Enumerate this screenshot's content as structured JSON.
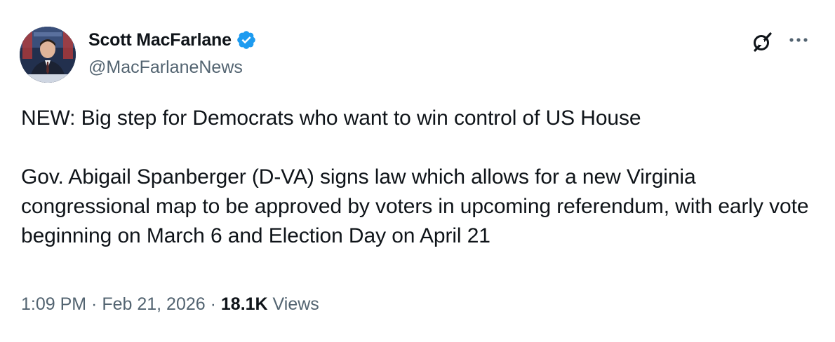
{
  "author": {
    "display_name": "Scott MacFarlane",
    "handle": "@MacFarlaneNews",
    "verified_icon": "verified-badge-icon",
    "avatar_icon": "avatar-photo"
  },
  "actions": {
    "grok_icon": "grok-icon",
    "more_icon": "more-horizontal-icon"
  },
  "tweet": {
    "text": "NEW:  Big step for Democrats who want to win control of US House\n\nGov. Abigail Spanberger (D-VA) signs law which allows for a new Virginia congressional map to be approved by voters in upcoming referendum, with early vote beginning on March 6 and Election Day on April 21"
  },
  "meta": {
    "time": "1:09 PM",
    "separator1": " · ",
    "date": "Feb 21, 2026",
    "separator2": " · ",
    "views_count": "18.1K",
    "views_label": " Views"
  },
  "colors": {
    "text_primary": "#0f1419",
    "text_secondary": "#536471",
    "verified_blue": "#1d9bf0",
    "background": "#ffffff"
  }
}
